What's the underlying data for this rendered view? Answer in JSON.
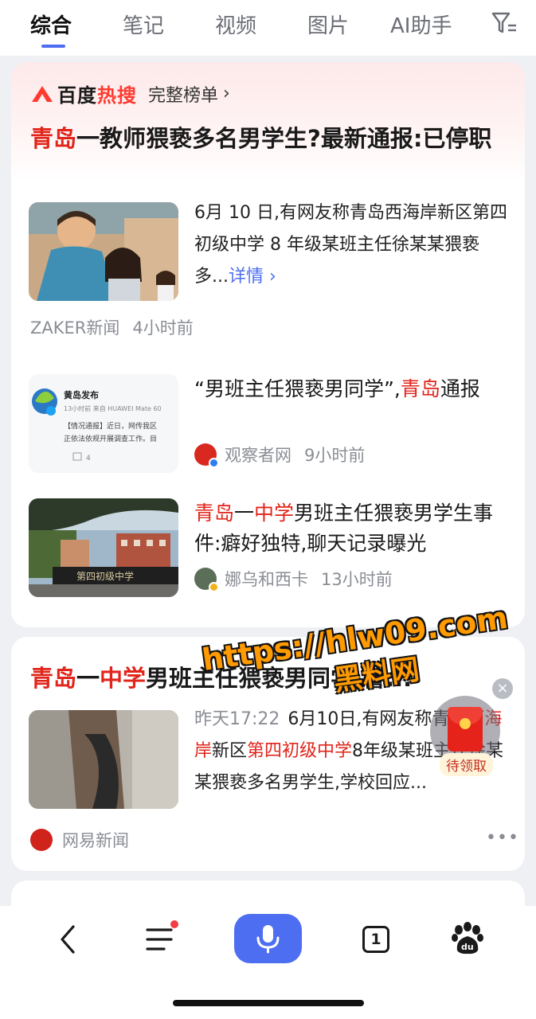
{
  "tabs": [
    "综合",
    "笔记",
    "视频",
    "图片",
    "AI助手"
  ],
  "hot": {
    "brand_a": "百度",
    "brand_b": "热搜",
    "full_list": "完整榜单",
    "chevron": "›"
  },
  "main": {
    "title_hl": "青岛",
    "title_rest": "一教师猥亵多名男学生?最新通报:已停职",
    "summary": "6月 10 日,有网友称青岛西海岸新区第四初级中学 8 年级某班主任徐某某猥亵多...",
    "detail": "详情 ›",
    "source": "ZAKER新闻",
    "time": "4小时前"
  },
  "sub1": {
    "title_a": "“男班主任猥亵男同学”,",
    "title_hl": "青岛",
    "title_b": "通报",
    "source": "观察者网",
    "time": "9小时前",
    "thumb_title": "黄岛发布",
    "thumb_meta": "13小时前 来自 HUAWEI Mate 60",
    "thumb_line1": "【情况通报】近日，网传我区",
    "thumb_line2": "正依法依规开展调查工作。目",
    "thumb_count": "4"
  },
  "sub2": {
    "title_hl1": "青岛",
    "title_a": "一",
    "title_hl2": "中学",
    "title_b": "男班主任猥亵男学生事件:癖好独特,聊天记录曝光",
    "source": "娜乌和西卡",
    "time": "13小时前",
    "thumb_sign": "第四初级中学"
  },
  "card2": {
    "title_hl1": "青岛",
    "title_a": "一",
    "title_hl2": "中学",
    "title_b": "男班主任猥亵男同学,警...",
    "time": "昨天17:22",
    "text_a": "6月10日,有网友称青岛西",
    "text_hl1": "海岸",
    "text_b": "新区",
    "text_hl2": "第四初级中学",
    "text_c": "8年级某班主任徐某某猥亵多名男学生,学校回应...",
    "source": "网易新闻",
    "more": "•••"
  },
  "redpacket": {
    "label": "待领取",
    "close": "×"
  },
  "watermark": {
    "url": "https://hlw09.com",
    "cn": "黑料网"
  },
  "bottom": {
    "tab_count": "1"
  },
  "colors": {
    "accent": "#4e6ef2",
    "highlight": "#e1251b",
    "hot_red": "#ff3b30"
  }
}
